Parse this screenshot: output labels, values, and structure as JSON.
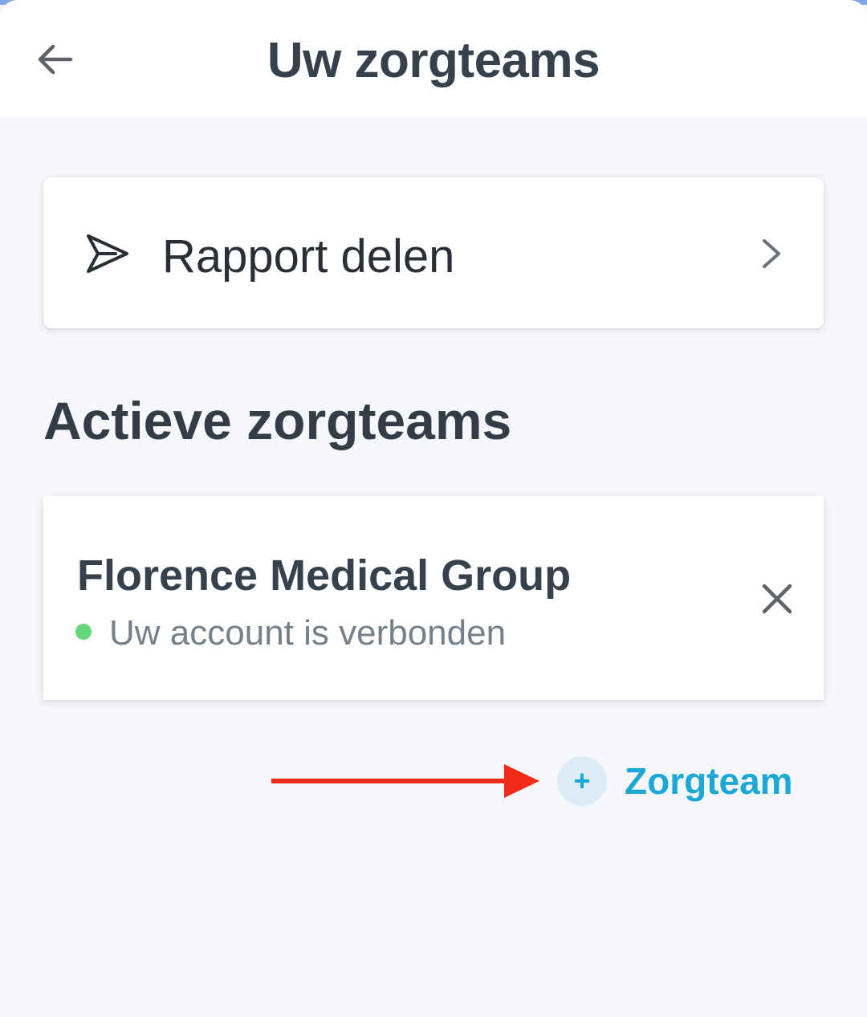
{
  "header": {
    "title": "Uw zorgteams",
    "back_icon": "arrow-left-icon"
  },
  "share_report": {
    "label": "Rapport delen",
    "icon": "send-icon",
    "chevron": "chevron-right-icon"
  },
  "active_teams": {
    "heading": "Actieve zorgteams",
    "teams": [
      {
        "name": "Florence Medical Group",
        "status": "Uw account is verbonden",
        "status_color": "#66d67a"
      }
    ]
  },
  "add_team": {
    "plus": "+",
    "label": "Zorgteam",
    "accent_color": "#1ba8d6"
  },
  "annotation": {
    "arrow_color": "#f02b17"
  },
  "colors": {
    "background": "#f5f7fb",
    "title": "#35424d",
    "text_muted": "#75808a"
  }
}
